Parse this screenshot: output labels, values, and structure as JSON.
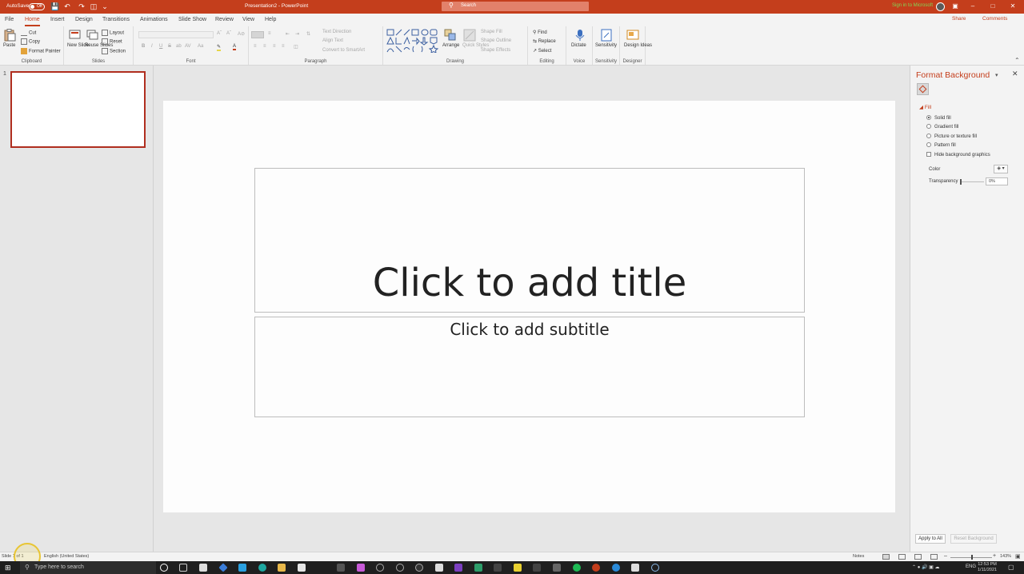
{
  "titlebar": {
    "autosave_label": "AutoSave",
    "autosave_state": "Off",
    "doc_title": "Presentation2 - PowerPoint",
    "search_placeholder": "Search",
    "user_name": "Sign in to Microsoft"
  },
  "tabs": [
    "File",
    "Home",
    "Insert",
    "Design",
    "Transitions",
    "Animations",
    "Slide Show",
    "Review",
    "View",
    "Help"
  ],
  "tab_active": "Home",
  "share_label": "Share",
  "comments_label": "Comments",
  "ribbon": {
    "clipboard": {
      "label": "Clipboard",
      "paste": "Paste",
      "cut": "Cut",
      "copy": "Copy",
      "format_painter": "Format Painter"
    },
    "slides": {
      "label": "Slides",
      "new_slide": "New Slide",
      "reuse_slides": "Reuse Slides",
      "layout": "Layout",
      "reset": "Reset",
      "section": "Section"
    },
    "font": {
      "label": "Font",
      "bold": "B",
      "italic": "I",
      "underline": "U",
      "strike": "S",
      "shadow": "ab",
      "spacing": "AV",
      "case": "Aa"
    },
    "paragraph": {
      "label": "Paragraph",
      "text_direction": "Text Direction",
      "align_text": "Align Text",
      "convert_smartart": "Convert to SmartArt"
    },
    "drawing": {
      "label": "Drawing",
      "arrange": "Arrange",
      "quick_styles": "Quick Styles",
      "shape_fill": "Shape Fill",
      "shape_outline": "Shape Outline",
      "shape_effects": "Shape Effects"
    },
    "editing": {
      "label": "Editing",
      "find": "Find",
      "replace": "Replace",
      "select": "Select"
    },
    "voice": {
      "label": "Voice",
      "dictate": "Dictate"
    },
    "sensitivity": {
      "label": "Sensitivity",
      "btn": "Sensitivity"
    },
    "designer": {
      "label": "Designer",
      "btn": "Design Ideas"
    }
  },
  "thumbnails": {
    "slide_number": "1"
  },
  "slide": {
    "title_placeholder": "Click to add title",
    "subtitle_placeholder": "Click to add subtitle"
  },
  "format_pane": {
    "title": "Format Background",
    "section": "Fill",
    "options": [
      "Solid fill",
      "Gradient fill",
      "Picture or texture fill",
      "Pattern fill"
    ],
    "selected_option": "Solid fill",
    "hide_bg_graphics": "Hide background graphics",
    "color_label": "Color",
    "transparency_label": "Transparency",
    "transparency_value": "0%",
    "apply_all": "Apply to All",
    "reset_bg": "Reset Background"
  },
  "statusbar": {
    "slide_info": "Slide 1 of 1",
    "language": "English (United States)",
    "notes": "Notes",
    "zoom": "143%"
  },
  "taskbar": {
    "search_placeholder": "Type here to search",
    "lang": "ENG",
    "time": "12:53 PM",
    "date": "1/11/2021"
  },
  "colors": {
    "accent": "#c43e1c",
    "thumb_border": "#b02e1f"
  }
}
